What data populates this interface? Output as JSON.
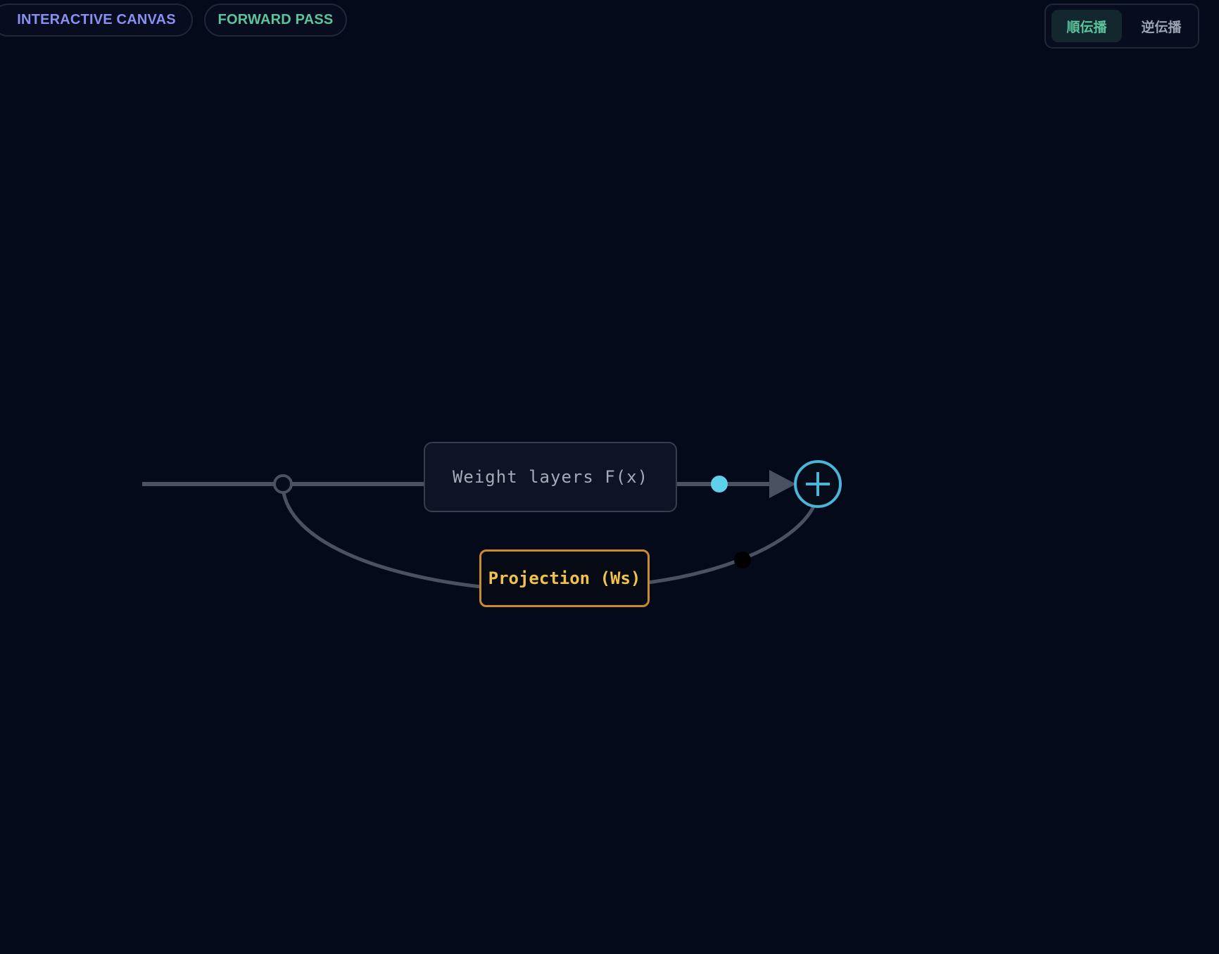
{
  "header": {
    "canvas_badge": "INTERACTIVE CANVAS",
    "mode_badge": "FORWARD PASS"
  },
  "toggle": {
    "forward_label": "順伝播",
    "backward_label": "逆伝播",
    "active": "forward"
  },
  "diagram": {
    "weight_node_label": "Weight layers F(x)",
    "projection_node_label": "Projection (Ws)",
    "add_symbol": "+"
  },
  "colors": {
    "background": "#040a1a",
    "canvas_badge_text": "#8b8ff0",
    "forward_accent": "#5cc39a",
    "active_toggle_bg": "#12282e",
    "inactive_toggle_text": "#9aa3b2",
    "edge": "#4a5262",
    "signal_dot": "#5fd0ea",
    "add_node": "#4ab5d6",
    "projection_border": "#c98a32",
    "projection_text": "#f2c14b"
  }
}
